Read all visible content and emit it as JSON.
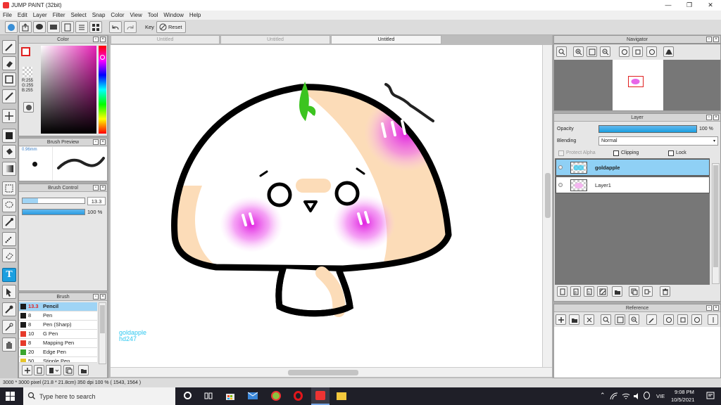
{
  "app": {
    "title": "JUMP PAINT (32bit)"
  },
  "menu": [
    "File",
    "Edit",
    "Layer",
    "Filter",
    "Select",
    "Snap",
    "Color",
    "View",
    "Tool",
    "Window",
    "Help"
  ],
  "toolbar": {
    "key_label": "Key",
    "reset_label": "Reset"
  },
  "tabs": [
    {
      "label": "Untitled"
    },
    {
      "label": "Untitled"
    },
    {
      "label": "Untitled"
    }
  ],
  "color_panel": {
    "title": "Color",
    "r": "R:255",
    "g": "G:255",
    "b": "B:255"
  },
  "brush_preview": {
    "title": "Brush Preview",
    "size": "0.96mm"
  },
  "brush_control": {
    "title": "Brush Control",
    "size_value": "13.3",
    "opacity_value": "100 %"
  },
  "brush_panel": {
    "title": "Brush",
    "items": [
      {
        "size": "13.3",
        "name": "Pencil",
        "color": "#1a1a1a"
      },
      {
        "size": "8",
        "name": "Pen",
        "color": "#1a1a1a"
      },
      {
        "size": "8",
        "name": "Pen (Sharp)",
        "color": "#1a1a1a"
      },
      {
        "size": "10",
        "name": "G Pen",
        "color": "#e63a2a"
      },
      {
        "size": "8",
        "name": "Mapping Pen",
        "color": "#e63a2a"
      },
      {
        "size": "20",
        "name": "Edge Pen",
        "color": "#3aa52e"
      },
      {
        "size": "50",
        "name": "Stipple Pen",
        "color": "#e6c52a"
      }
    ]
  },
  "navigator": {
    "title": "Navigator"
  },
  "layer_panel": {
    "title": "Layer",
    "opacity_label": "Opacity",
    "opacity_value": "100 %",
    "blending_label": "Blending",
    "blending_value": "Normal",
    "protect_alpha": "Protect Alpha",
    "clipping": "Clipping",
    "lock": "Lock",
    "layers": [
      {
        "name": "goldapple"
      },
      {
        "name": "Layer1"
      }
    ]
  },
  "reference_panel": {
    "title": "Reference"
  },
  "canvas": {
    "signature_line1": "goldapple",
    "signature_line2": "hd247"
  },
  "status": {
    "text": "3000 * 3000 pixel   (21.8 * 21.8cm)   350 dpi   100 %   ( 1543, 1564 )"
  },
  "taskbar": {
    "search_placeholder": "Type here to search",
    "language": "VIE",
    "time": "9:08 PM",
    "date": "10/5/2021"
  },
  "colors": {
    "accent": "#1a9fe0",
    "active_layer": "#8fd0f5",
    "blush": "#e01fe0",
    "skin": "#fcdcb8",
    "leaf": "#3cc420"
  }
}
